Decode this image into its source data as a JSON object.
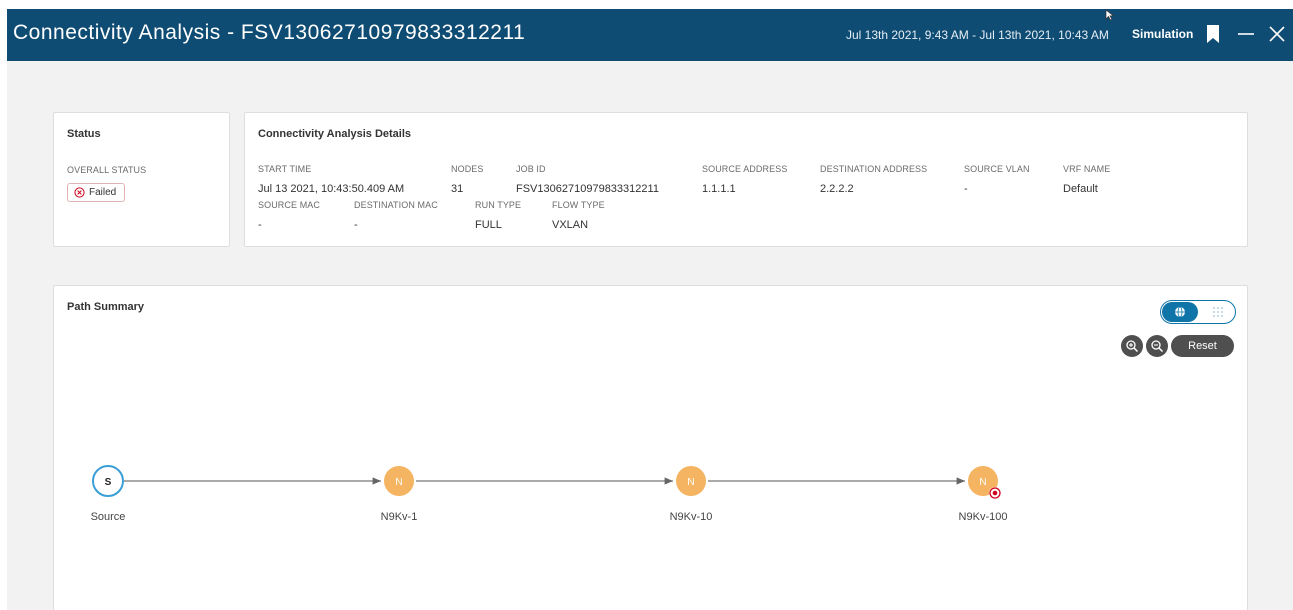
{
  "header": {
    "title": "Connectivity Analysis - FSV13062710979833312211",
    "time_range": "Jul 13th 2021, 9:43 AM - Jul 13th 2021, 10:43 AM",
    "mode": "Simulation"
  },
  "status": {
    "heading": "Status",
    "overall_label": "OVERALL STATUS",
    "overall_value": "Failed",
    "status_color": "#d0021b"
  },
  "details": {
    "heading": "Connectivity Analysis Details",
    "row1": [
      {
        "label": "START TIME",
        "value": "Jul 13 2021, 10:43:50.409 AM"
      },
      {
        "label": "NODES",
        "value": "31"
      },
      {
        "label": "JOB ID",
        "value": "FSV13062710979833312211"
      },
      {
        "label": "SOURCE ADDRESS",
        "value": "1.1.1.1"
      },
      {
        "label": "DESTINATION ADDRESS",
        "value": "2.2.2.2"
      },
      {
        "label": "SOURCE VLAN",
        "value": "-"
      },
      {
        "label": "VRF NAME",
        "value": "Default"
      }
    ],
    "row2": [
      {
        "label": "SOURCE MAC",
        "value": "-"
      },
      {
        "label": "DESTINATION MAC",
        "value": "-"
      },
      {
        "label": "RUN TYPE",
        "value": "FULL"
      },
      {
        "label": "FLOW TYPE",
        "value": "VXLAN"
      }
    ]
  },
  "path_summary": {
    "heading": "Path Summary",
    "reset_label": "Reset",
    "nodes": [
      {
        "letter": "S",
        "name": "Source",
        "kind": "source"
      },
      {
        "letter": "N",
        "name": "N9Kv-1",
        "kind": "switch"
      },
      {
        "letter": "N",
        "name": "N9Kv-10",
        "kind": "switch"
      },
      {
        "letter": "N",
        "name": "N9Kv-100",
        "kind": "destination"
      }
    ]
  },
  "colors": {
    "titlebar": "#0f4c74",
    "accent": "#0f75a8",
    "switch_node": "#f5b461",
    "source_ring": "#3a9fd6",
    "target_marker": "#d0021b"
  }
}
